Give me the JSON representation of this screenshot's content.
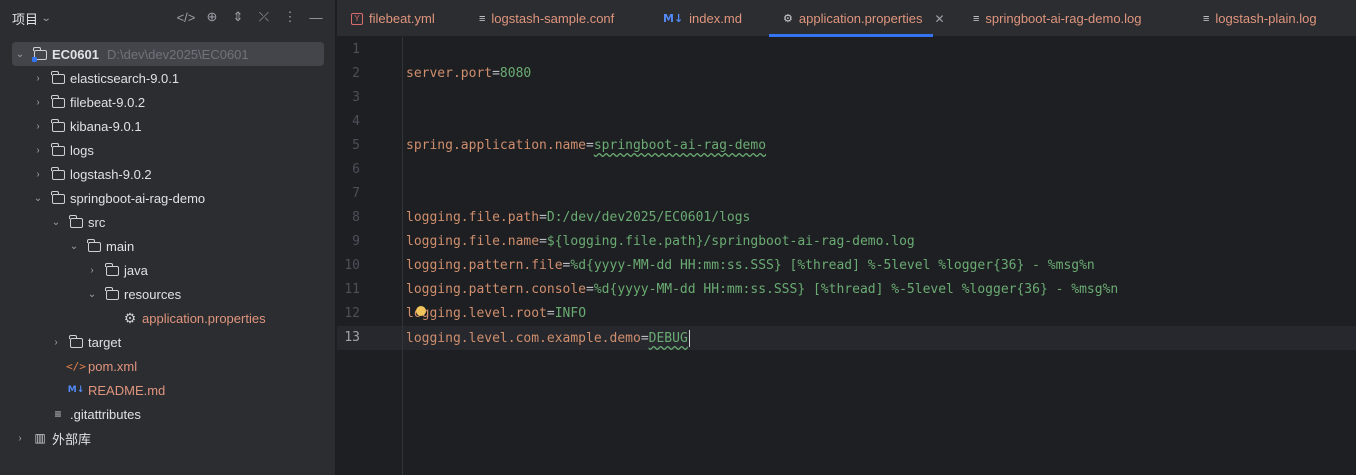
{
  "project": {
    "title": "项目",
    "root": {
      "name": "EC0601",
      "path": "D:\\dev\\dev2025\\EC0601"
    },
    "items": [
      {
        "label": "elasticsearch-9.0.1"
      },
      {
        "label": "filebeat-9.0.2"
      },
      {
        "label": "kibana-9.0.1"
      },
      {
        "label": "logs"
      },
      {
        "label": "logstash-9.0.2"
      },
      {
        "label": "springboot-ai-rag-demo"
      },
      {
        "label": "src"
      },
      {
        "label": "main"
      },
      {
        "label": "java"
      },
      {
        "label": "resources"
      },
      {
        "label": "application.properties"
      },
      {
        "label": "target"
      },
      {
        "label": "pom.xml"
      },
      {
        "label": "README.md"
      },
      {
        "label": ".gitattributes"
      },
      {
        "label": "外部库"
      }
    ]
  },
  "tabs": [
    {
      "label": "filebeat.yml"
    },
    {
      "label": "logstash-sample.conf"
    },
    {
      "label": "index.md",
      "icon_text": "M↓"
    },
    {
      "label": "application.properties",
      "active": true
    },
    {
      "label": "springboot-ai-rag-demo.log"
    },
    {
      "label": "logstash-plain.log"
    }
  ],
  "editor": {
    "line_numbers": [
      "1",
      "2",
      "3",
      "4",
      "5",
      "6",
      "7",
      "8",
      "9",
      "10",
      "11",
      "12",
      "13"
    ],
    "lines": {
      "l2_key": "server.port",
      "l2_val": "8080",
      "l5_key": "spring.application.name",
      "l5_val": "springboot-ai-rag-demo",
      "l8_key": "logging.file.path",
      "l8_val": "D:/dev/dev2025/EC0601/logs",
      "l9_key": "logging.file.name",
      "l9_val": "${logging.file.path}/springboot-ai-rag-demo.log",
      "l10_key": "logging.pattern.file",
      "l10_val": "%d{yyyy-MM-dd HH:mm:ss.SSS} [%thread] %-5level %logger{36} - %msg%n",
      "l11_key": "logging.pattern.console",
      "l11_val": "%d{yyyy-MM-dd HH:mm:ss.SSS} [%thread] %-5level %logger{36} - %msg%n",
      "l12_key": "logging.level.root",
      "l12_val": "INFO",
      "l13_key": "logging.level.com.example.demo",
      "l13_val": "DEBUG"
    },
    "equals": "="
  },
  "colors": {
    "accent": "#3574f0",
    "key": "#cf8e6d",
    "value": "#6aab73",
    "modified_file": "#e0957e"
  }
}
